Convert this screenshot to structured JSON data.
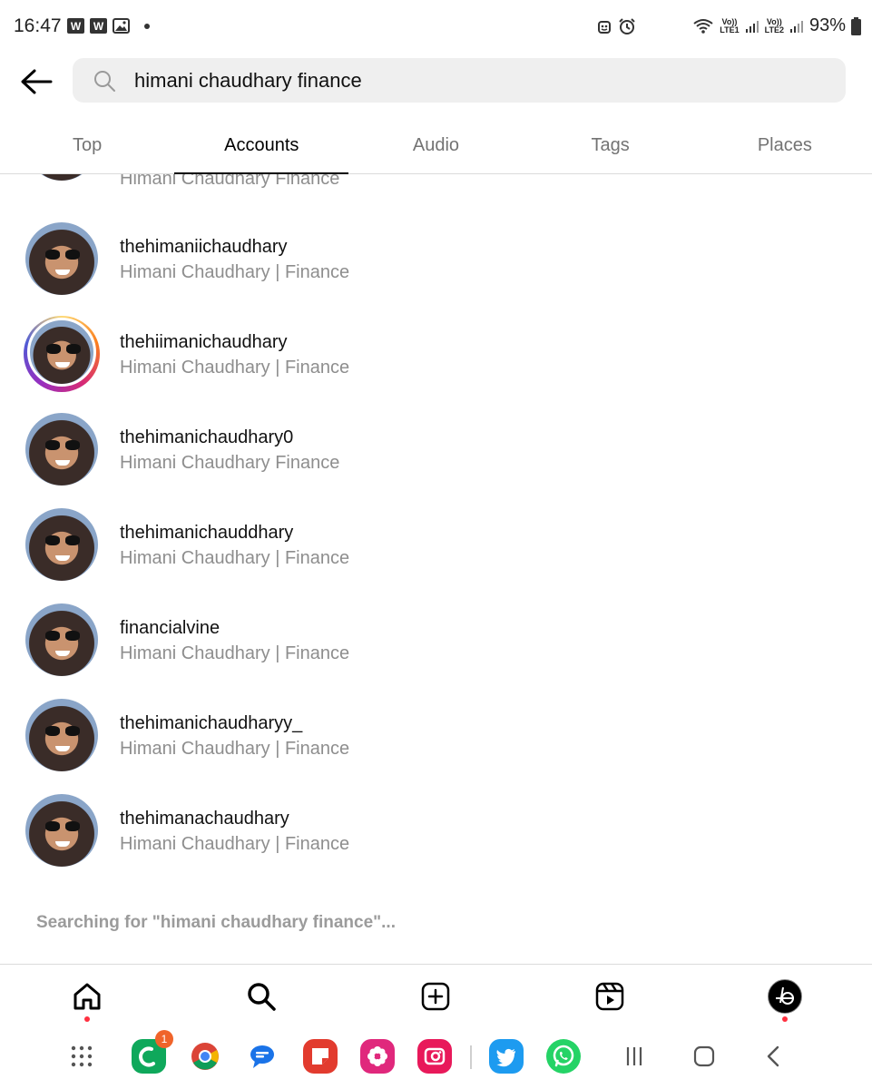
{
  "status_bar": {
    "time": "16:47",
    "battery": "93%",
    "notif_icons": [
      "W",
      "W"
    ],
    "sim1": "LTE1",
    "sim2": "LTE2",
    "volte": "Vo))"
  },
  "search": {
    "query": "himani chaudhary finance",
    "icons": [
      "back-arrow-icon",
      "search-icon"
    ]
  },
  "tabs": [
    {
      "label": "Top",
      "active": false
    },
    {
      "label": "Accounts",
      "active": true
    },
    {
      "label": "Audio",
      "active": false
    },
    {
      "label": "Tags",
      "active": false
    },
    {
      "label": "Places",
      "active": false
    }
  ],
  "results": {
    "partial_top_subtitle": "Himani Chaudhary Finance",
    "items": [
      {
        "username": "thehimaniichaudhary",
        "full_name": "Himani Chaudhary | Finance",
        "story": false
      },
      {
        "username": "thehiimanichaudhary",
        "full_name": "Himani Chaudhary | Finance",
        "story": true
      },
      {
        "username": "thehimanichaudhary0",
        "full_name": "Himani Chaudhary Finance",
        "story": false
      },
      {
        "username": "thehimanichauddhary",
        "full_name": "Himani Chaudhary | Finance",
        "story": false
      },
      {
        "username": "financialvine",
        "full_name": "Himani Chaudhary | Finance",
        "story": false
      },
      {
        "username": "thehimanichaudharyy_",
        "full_name": "Himani Chaudhary | Finance",
        "story": false
      },
      {
        "username": "thehimanachaudhary",
        "full_name": "Himani Chaudhary | Finance",
        "story": false
      }
    ]
  },
  "searching_text": "Searching for \"himani chaudhary finance\"...",
  "bottom_nav": [
    "home-icon",
    "search-icon",
    "create-icon",
    "reels-icon",
    "profile-avatar"
  ],
  "dock": {
    "badge_count": "1",
    "apps": [
      "app-drawer-icon",
      "phone-app-icon",
      "chrome-icon",
      "messages-icon",
      "notes-icon",
      "flower-app-icon",
      "instagram-icon",
      "twitter-icon",
      "whatsapp-icon"
    ],
    "nav": [
      "recents-icon",
      "home-nav-icon",
      "back-nav-icon"
    ]
  },
  "colors": {
    "accent_red": "#ff3040",
    "muted_text": "#8e8e8e",
    "search_bg": "#efefef"
  }
}
